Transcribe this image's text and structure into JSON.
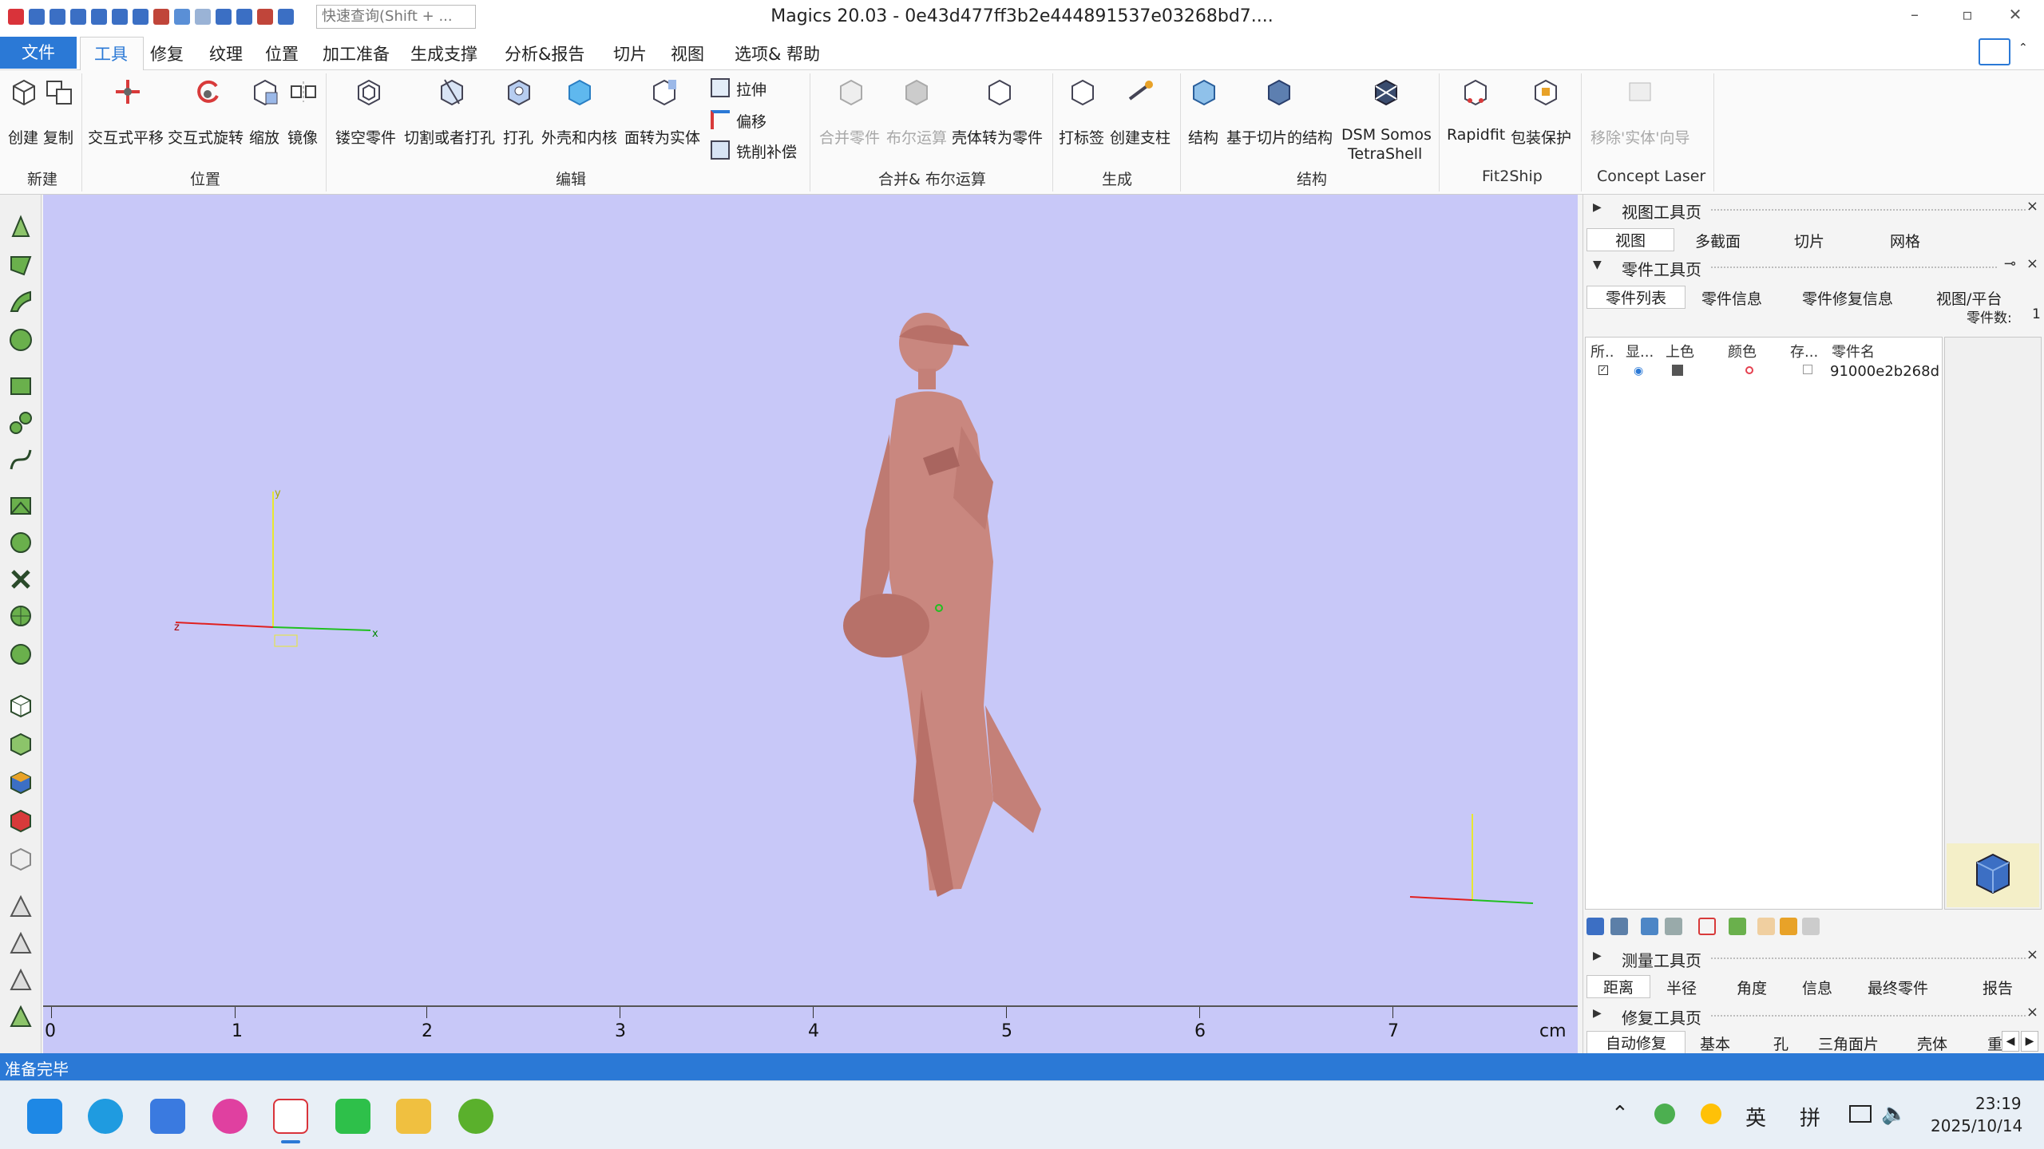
{
  "window": {
    "title": "Magics 20.03 - 0e43d477ff3b2e444891537e03268bd7....",
    "search_placeholder": "快速查询(Shift + ..."
  },
  "menu": {
    "tabs": [
      "文件",
      "工具",
      "修复",
      "纹理",
      "位置",
      "加工准备",
      "生成支撑",
      "分析&报告",
      "切片",
      "视图",
      "选项& 帮助"
    ],
    "selected": "工具"
  },
  "ribbon": {
    "buttons": {
      "create": "创建",
      "copy": "复制",
      "interactive_translate": "交互式平移",
      "interactive_rotate": "交互式旋转",
      "scale": "缩放",
      "mirror": "镜像",
      "hollow": "镂空零件",
      "cut_or_punch": "切割或者打孔",
      "punch": "打孔",
      "shell_core": "外壳和内核",
      "surface_to_solid": "面转为实体",
      "extrude": "拉伸",
      "offset": "偏移",
      "mill_comp": "铣削补偿",
      "merge_parts": "合并零件",
      "boolean": "布尔运算",
      "shell_to_part": "壳体转为零件",
      "label": "打标签",
      "create_pillar": "创建支柱",
      "structure": "结构",
      "slice_structure": "基于切片的结构",
      "dsm_1": "DSM Somos",
      "dsm_2": "TetraShell",
      "rapidfit": "Rapidfit",
      "package_protect": "包装保护",
      "remove_solid_wizard": "移除'实体'向导"
    },
    "groups": {
      "new": "新建",
      "position": "位置",
      "edit": "编辑",
      "merge_boolean": "合并& 布尔运算",
      "generate": "生成",
      "structure": "结构",
      "fit2ship": "Fit2Ship",
      "concept_laser": "Concept Laser"
    }
  },
  "viewport": {
    "ruler": {
      "ticks": [
        "0",
        "1",
        "2",
        "3",
        "4",
        "5",
        "6",
        "7"
      ],
      "unit": "cm"
    },
    "axis_labels": {
      "x": "x",
      "y": "y",
      "z": "z"
    }
  },
  "right_panel": {
    "view_tools": {
      "title": "视图工具页",
      "tabs": [
        "视图",
        "多截面",
        "切片",
        "网格"
      ]
    },
    "part_tools": {
      "title": "零件工具页",
      "tabs": [
        "零件列表",
        "零件信息",
        "零件修复信息",
        "视图/平台"
      ],
      "part_count_label": "零件数:",
      "part_count": "1",
      "columns": [
        "所..",
        "显...",
        "上色",
        "颜色",
        "存...",
        "零件名"
      ],
      "rows": [
        {
          "name": "91000e2b268d",
          "color": "#e5404f"
        }
      ]
    },
    "measure_tools": {
      "title": "测量工具页",
      "tabs": [
        "距离",
        "半径",
        "角度",
        "信息",
        "最终零件",
        "报告"
      ]
    },
    "fix_tools": {
      "title": "修复工具页",
      "tabs": [
        "自动修复",
        "基本",
        "孔",
        "三角面片",
        "壳体",
        "重"
      ]
    }
  },
  "status": {
    "text": "准备完毕"
  },
  "taskbar": {
    "time": "23:19",
    "date": "2025/10/14",
    "ime_1": "英",
    "ime_2": "拼"
  },
  "colors": {
    "accent": "#2b79d6",
    "viewport_bg": "#c8c8f8",
    "model": "#c9877f"
  }
}
